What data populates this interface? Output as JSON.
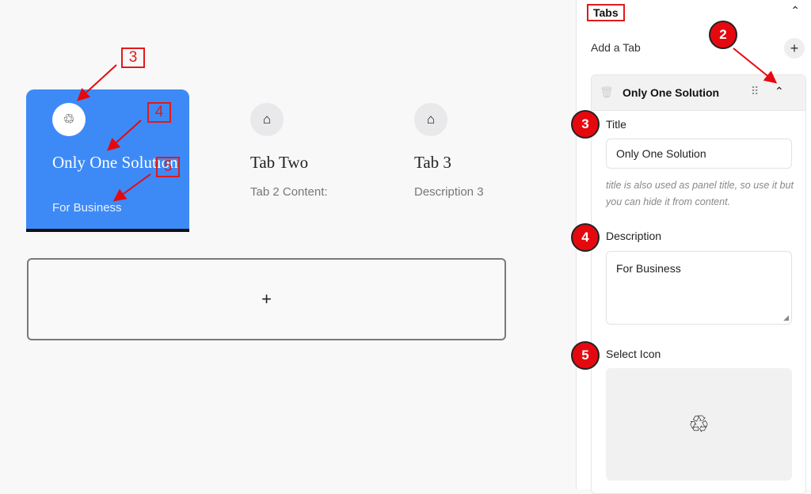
{
  "canvas": {
    "tabs": [
      {
        "title": "Only One Solution",
        "description": "For Business",
        "icon": "recycle-icon",
        "icon_glyph": "♲",
        "active": true
      },
      {
        "title": "Tab Two",
        "description": "Tab 2 Content:",
        "icon": "home-icon",
        "icon_glyph": "⌂",
        "active": false
      },
      {
        "title": "Tab 3",
        "description": "Description 3",
        "icon": "home-icon",
        "icon_glyph": "⌂",
        "active": false
      }
    ],
    "add_block_glyph": "+",
    "active_color": "#3d8af7"
  },
  "annotations": {
    "box_3": "3",
    "box_4": "4",
    "box_5": "5",
    "circle_2": "2",
    "circle_3": "3",
    "circle_4": "4",
    "circle_5": "5"
  },
  "sidebar": {
    "section_title": "Tabs",
    "collapse_glyph": "⌃",
    "add_tab_label": "Add a Tab",
    "add_tab_glyph": "+",
    "item": {
      "title": "Only One Solution",
      "trash_glyph": "🗑",
      "drag_glyph": "⠿",
      "chevron_glyph": "⌃",
      "fields": {
        "title_label": "Title",
        "title_value": "Only One Solution",
        "title_hint": "title is also used as panel title, so use it but you can hide it from content.",
        "description_label": "Description",
        "description_value": "For Business",
        "icon_label": "Select Icon",
        "icon_glyph": "♲"
      }
    }
  }
}
